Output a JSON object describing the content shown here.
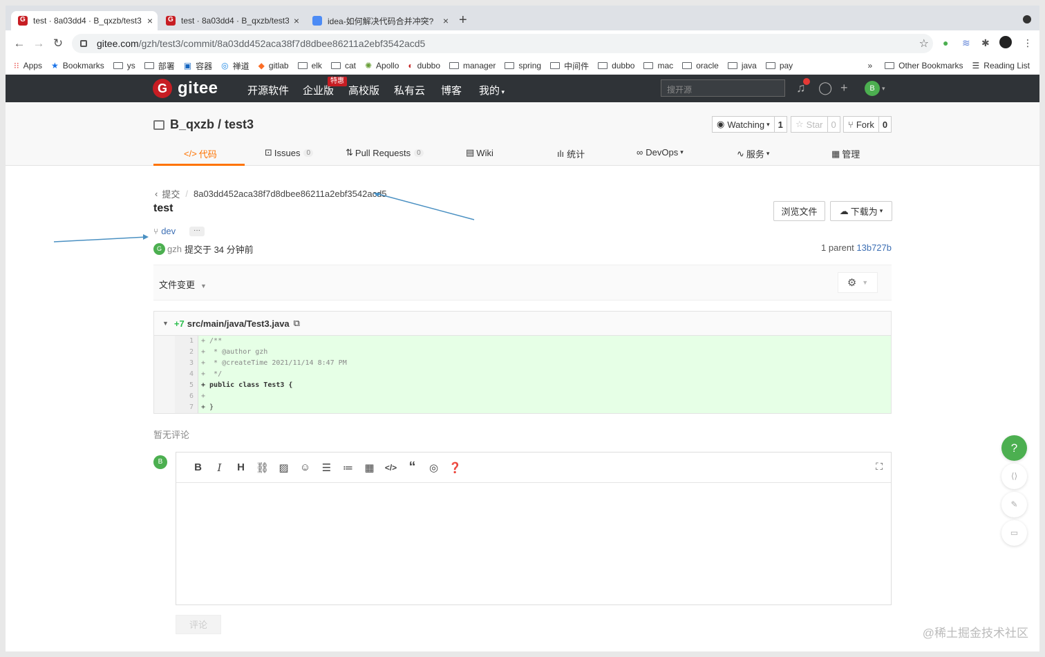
{
  "tabs": [
    {
      "title": "test · 8a03dd4 · B_qxzb/test3",
      "close": "×"
    },
    {
      "title": "test · 8a03dd4 · B_qxzb/test3",
      "close": "×"
    },
    {
      "title": "idea-如何解决代码合并冲突?",
      "close": "×"
    }
  ],
  "new_tab": "+",
  "url": {
    "domain": "gitee.com",
    "path": "/gzh/test3/commit/8a03dd452aca38f7d8dbee86211a2ebf3542acd5"
  },
  "bookmarks": [
    "Apps",
    "Bookmarks",
    "ys",
    "部署",
    "容器",
    "禅道",
    "gitlab",
    "elk",
    "cat",
    "Apollo",
    "dubbo",
    "manager",
    "spring",
    "中间件",
    "dubbo",
    "mac",
    "oracle",
    "java",
    "pay"
  ],
  "bookmarks_more": "»",
  "bookmarks_other": "Other Bookmarks",
  "reading_list": "Reading List",
  "nav": {
    "logo": "gitee",
    "items": [
      "开源软件",
      "企业版",
      "高校版",
      "私有云",
      "博客",
      "我的"
    ],
    "badge": "特惠",
    "search_placeholder": "搜开源",
    "avatar": "B"
  },
  "repo": {
    "owner": "B_qxzb",
    "sep": " / ",
    "name": "test3",
    "watch": "Watching",
    "watch_count": "1",
    "star": "Star",
    "star_count": "0",
    "fork": "Fork",
    "fork_count": "0"
  },
  "repo_tabs": [
    {
      "label": "代码",
      "count": ""
    },
    {
      "label": "Issues",
      "count": "0"
    },
    {
      "label": "Pull Requests",
      "count": "0"
    },
    {
      "label": "Wiki",
      "count": ""
    },
    {
      "label": "统计",
      "count": ""
    },
    {
      "label": "DevOps",
      "count": ""
    },
    {
      "label": "服务",
      "count": ""
    },
    {
      "label": "管理",
      "count": ""
    }
  ],
  "breadcrumb": {
    "parent": "提交",
    "sha": "8a03dd452aca38f7d8dbee86211a2ebf3542acd5"
  },
  "commit": {
    "title": "test",
    "branch": "dev",
    "ellipsis": "···",
    "author": "gzh",
    "author_avatar": "G",
    "time": "提交于 34 分钟前",
    "parent_label": "1 parent",
    "parent_sha": "13b727b",
    "browse": "浏览文件",
    "download": "下载为"
  },
  "files_label": "文件变更",
  "diff": {
    "additions": "+7",
    "path": "src/main/java/Test3.java",
    "lines": [
      {
        "n": "1",
        "code": "+ /**"
      },
      {
        "n": "2",
        "code": "+  * @author gzh"
      },
      {
        "n": "3",
        "code": "+  * @createTime 2021/11/14 8:47 PM"
      },
      {
        "n": "4",
        "code": "+  */"
      },
      {
        "n": "5",
        "code": "+ public class Test3 {"
      },
      {
        "n": "6",
        "code": "+"
      },
      {
        "n": "7",
        "code": "+ }"
      }
    ]
  },
  "no_comments": "暂无评论",
  "comment_avatar": "B",
  "submit": "评论",
  "help": "?",
  "watermark": "@稀土掘金技术社区"
}
